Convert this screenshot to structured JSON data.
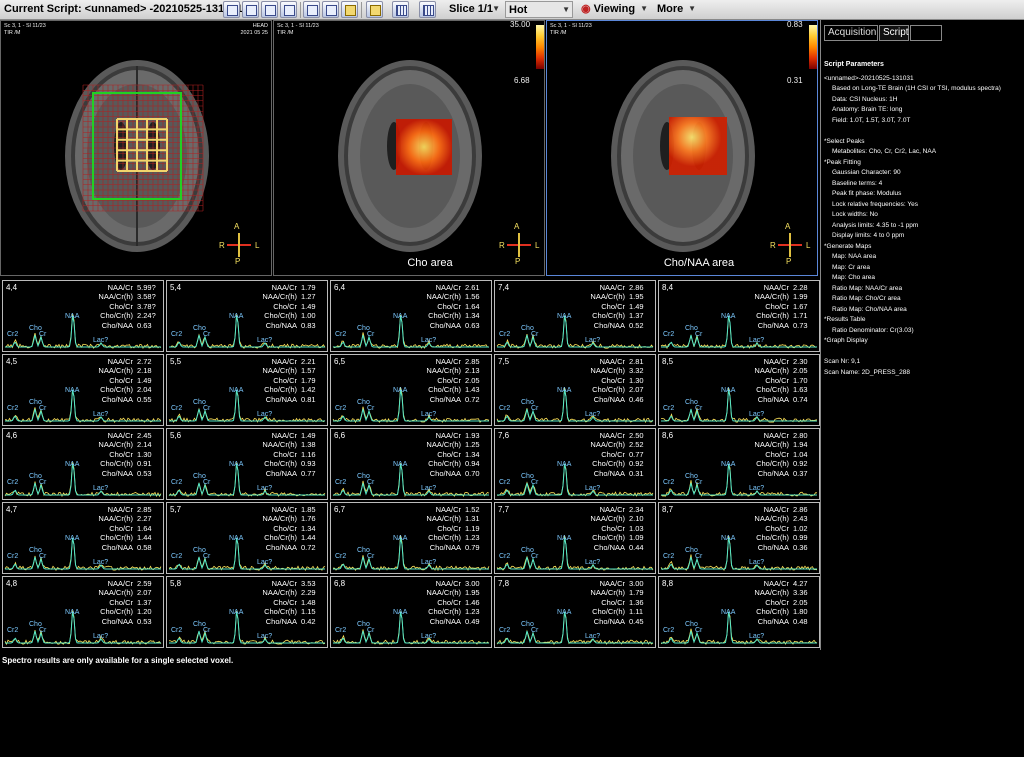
{
  "toolbar": {
    "current_script_label": "Current Script: <unnamed> -20210525-131031",
    "slice_label": "Slice 1/1",
    "lut_label": "Hot",
    "viewing_label": "Viewing",
    "more_label": "More"
  },
  "viewports": [
    {
      "info_tl": "Sc 3, 1 - Sl 11/23",
      "info_tl2": "TIR  /M",
      "info_tr": "HEAD",
      "info_tr2": "2021 05 25",
      "colorbar": null,
      "area_label": ""
    },
    {
      "info_tl": "Sc 3, 1 - Sl 11/23",
      "info_tl2": "TIR  /M",
      "info_tr": "",
      "info_tr2": "2021 05 25",
      "colorbar": {
        "max": "35.00",
        "min": "6.68"
      },
      "area_label": "Cho area"
    },
    {
      "info_tl": "Sc 3, 1 - Sl 11/23",
      "info_tl2": "TIR  /M",
      "info_tr": "",
      "info_tr2": "2021 05 25",
      "colorbar": {
        "max": "0.83",
        "min": "0.31"
      },
      "area_label": "Cho/NAA area"
    }
  ],
  "orientation": {
    "anterior": "A",
    "posterior": "P",
    "right": "R",
    "left": "L"
  },
  "peak_labels": {
    "cr2": "Cr2",
    "cho": "Cho",
    "cr": "Cr",
    "naa": "NAA",
    "lac": "Lac?"
  },
  "spectra": [
    {
      "coord": "4,4",
      "ratios": [
        [
          "NAA/Cr",
          "5.99?"
        ],
        [
          "NAA/Cr(h)",
          "3.58?"
        ],
        [
          "Cho/Cr",
          "3.78?"
        ],
        [
          "Cho/Cr(h)",
          "2.24?"
        ],
        [
          "Cho/NAA",
          "0.63"
        ]
      ]
    },
    {
      "coord": "5,4",
      "ratios": [
        [
          "NAA/Cr",
          "1.79"
        ],
        [
          "NAA/Cr(h)",
          "1.27"
        ],
        [
          "Cho/Cr",
          "1.49"
        ],
        [
          "Cho/Cr(h)",
          "1.00"
        ],
        [
          "Cho/NAA",
          "0.83"
        ]
      ]
    },
    {
      "coord": "6,4",
      "ratios": [
        [
          "NAA/Cr",
          "2.61"
        ],
        [
          "NAA/Cr(h)",
          "1.56"
        ],
        [
          "Cho/Cr",
          "1.64"
        ],
        [
          "Cho/Cr(h)",
          "1.34"
        ],
        [
          "Cho/NAA",
          "0.63"
        ]
      ]
    },
    {
      "coord": "7,4",
      "ratios": [
        [
          "NAA/Cr",
          "2.86"
        ],
        [
          "NAA/Cr(h)",
          "1.95"
        ],
        [
          "Cho/Cr",
          "1.49"
        ],
        [
          "Cho/Cr(h)",
          "1.37"
        ],
        [
          "Cho/NAA",
          "0.52"
        ]
      ]
    },
    {
      "coord": "8,4",
      "ratios": [
        [
          "NAA/Cr",
          "2.28"
        ],
        [
          "NAA/Cr(h)",
          "1.99"
        ],
        [
          "Cho/Cr",
          "1.67"
        ],
        [
          "Cho/Cr(h)",
          "1.71"
        ],
        [
          "Cho/NAA",
          "0.73"
        ]
      ]
    },
    {
      "coord": "4,5",
      "ratios": [
        [
          "NAA/Cr",
          "2.72"
        ],
        [
          "NAA/Cr(h)",
          "2.18"
        ],
        [
          "Cho/Cr",
          "1.49"
        ],
        [
          "Cho/Cr(h)",
          "2.04"
        ],
        [
          "Cho/NAA",
          "0.55"
        ]
      ]
    },
    {
      "coord": "5,5",
      "ratios": [
        [
          "NAA/Cr",
          "2.21"
        ],
        [
          "NAA/Cr(h)",
          "1.57"
        ],
        [
          "Cho/Cr",
          "1.79"
        ],
        [
          "Cho/Cr(h)",
          "1.42"
        ],
        [
          "Cho/NAA",
          "0.81"
        ]
      ]
    },
    {
      "coord": "6,5",
      "ratios": [
        [
          "NAA/Cr",
          "2.85"
        ],
        [
          "NAA/Cr(h)",
          "2.13"
        ],
        [
          "Cho/Cr",
          "2.05"
        ],
        [
          "Cho/Cr(h)",
          "1.43"
        ],
        [
          "Cho/NAA",
          "0.72"
        ]
      ]
    },
    {
      "coord": "7,5",
      "ratios": [
        [
          "NAA/Cr",
          "2.81"
        ],
        [
          "NAA/Cr(h)",
          "3.32"
        ],
        [
          "Cho/Cr",
          "1.30"
        ],
        [
          "Cho/Cr(h)",
          "2.07"
        ],
        [
          "Cho/NAA",
          "0.46"
        ]
      ]
    },
    {
      "coord": "8,5",
      "ratios": [
        [
          "NAA/Cr",
          "2.30"
        ],
        [
          "NAA/Cr(h)",
          "2.05"
        ],
        [
          "Cho/Cr",
          "1.70"
        ],
        [
          "Cho/Cr(h)",
          "1.63"
        ],
        [
          "Cho/NAA",
          "0.74"
        ]
      ]
    },
    {
      "coord": "4,6",
      "ratios": [
        [
          "NAA/Cr",
          "2.45"
        ],
        [
          "NAA/Cr(h)",
          "2.14"
        ],
        [
          "Cho/Cr",
          "1.30"
        ],
        [
          "Cho/Cr(h)",
          "0.91"
        ],
        [
          "Cho/NAA",
          "0.53"
        ]
      ]
    },
    {
      "coord": "5,6",
      "ratios": [
        [
          "NAA/Cr",
          "1.49"
        ],
        [
          "NAA/Cr(h)",
          "1.38"
        ],
        [
          "Cho/Cr",
          "1.16"
        ],
        [
          "Cho/Cr(h)",
          "0.93"
        ],
        [
          "Cho/NAA",
          "0.77"
        ]
      ]
    },
    {
      "coord": "6,6",
      "ratios": [
        [
          "NAA/Cr",
          "1.93"
        ],
        [
          "NAA/Cr(h)",
          "1.25"
        ],
        [
          "Cho/Cr",
          "1.34"
        ],
        [
          "Cho/Cr(h)",
          "0.94"
        ],
        [
          "Cho/NAA",
          "0.70"
        ]
      ]
    },
    {
      "coord": "7,6",
      "ratios": [
        [
          "NAA/Cr",
          "2.50"
        ],
        [
          "NAA/Cr(h)",
          "2.52"
        ],
        [
          "Cho/Cr",
          "0.77"
        ],
        [
          "Cho/Cr(h)",
          "0.92"
        ],
        [
          "Cho/NAA",
          "0.31"
        ]
      ]
    },
    {
      "coord": "8,6",
      "ratios": [
        [
          "NAA/Cr",
          "2.80"
        ],
        [
          "NAA/Cr(h)",
          "1.94"
        ],
        [
          "Cho/Cr",
          "1.04"
        ],
        [
          "Cho/Cr(h)",
          "0.92"
        ],
        [
          "Cho/NAA",
          "0.37"
        ]
      ]
    },
    {
      "coord": "4,7",
      "ratios": [
        [
          "NAA/Cr",
          "2.85"
        ],
        [
          "NAA/Cr(h)",
          "2.27"
        ],
        [
          "Cho/Cr",
          "1.64"
        ],
        [
          "Cho/Cr(h)",
          "1.44"
        ],
        [
          "Cho/NAA",
          "0.58"
        ]
      ]
    },
    {
      "coord": "5,7",
      "ratios": [
        [
          "NAA/Cr",
          "1.85"
        ],
        [
          "NAA/Cr(h)",
          "1.76"
        ],
        [
          "Cho/Cr",
          "1.34"
        ],
        [
          "Cho/Cr(h)",
          "1.44"
        ],
        [
          "Cho/NAA",
          "0.72"
        ]
      ]
    },
    {
      "coord": "6,7",
      "ratios": [
        [
          "NAA/Cr",
          "1.52"
        ],
        [
          "NAA/Cr(h)",
          "1.31"
        ],
        [
          "Cho/Cr",
          "1.19"
        ],
        [
          "Cho/Cr(h)",
          "1.23"
        ],
        [
          "Cho/NAA",
          "0.79"
        ]
      ]
    },
    {
      "coord": "7,7",
      "ratios": [
        [
          "NAA/Cr",
          "2.34"
        ],
        [
          "NAA/Cr(h)",
          "2.10"
        ],
        [
          "Cho/Cr",
          "1.03"
        ],
        [
          "Cho/Cr(h)",
          "1.09"
        ],
        [
          "Cho/NAA",
          "0.44"
        ]
      ]
    },
    {
      "coord": "8,7",
      "ratios": [
        [
          "NAA/Cr",
          "2.86"
        ],
        [
          "NAA/Cr(h)",
          "2.43"
        ],
        [
          "Cho/Cr",
          "1.02"
        ],
        [
          "Cho/Cr(h)",
          "0.99"
        ],
        [
          "Cho/NAA",
          "0.36"
        ]
      ]
    },
    {
      "coord": "4,8",
      "ratios": [
        [
          "NAA/Cr",
          "2.59"
        ],
        [
          "NAA/Cr(h)",
          "2.07"
        ],
        [
          "Cho/Cr",
          "1.37"
        ],
        [
          "Cho/Cr(h)",
          "1.20"
        ],
        [
          "Cho/NAA",
          "0.53"
        ]
      ]
    },
    {
      "coord": "5,8",
      "ratios": [
        [
          "NAA/Cr",
          "3.53"
        ],
        [
          "NAA/Cr(h)",
          "2.29"
        ],
        [
          "Cho/Cr",
          "1.48"
        ],
        [
          "Cho/Cr(h)",
          "1.15"
        ],
        [
          "Cho/NAA",
          "0.42"
        ]
      ]
    },
    {
      "coord": "6,8",
      "ratios": [
        [
          "NAA/Cr",
          "3.00"
        ],
        [
          "NAA/Cr(h)",
          "1.95"
        ],
        [
          "Cho/Cr",
          "1.46"
        ],
        [
          "Cho/Cr(h)",
          "1.23"
        ],
        [
          "Cho/NAA",
          "0.49"
        ]
      ]
    },
    {
      "coord": "7,8",
      "ratios": [
        [
          "NAA/Cr",
          "3.00"
        ],
        [
          "NAA/Cr(h)",
          "1.79"
        ],
        [
          "Cho/Cr",
          "1.36"
        ],
        [
          "Cho/Cr(h)",
          "1.11"
        ],
        [
          "Cho/NAA",
          "0.45"
        ]
      ]
    },
    {
      "coord": "8,8",
      "ratios": [
        [
          "NAA/Cr",
          "4.27"
        ],
        [
          "NAA/Cr(h)",
          "3.36"
        ],
        [
          "Cho/Cr",
          "2.05"
        ],
        [
          "Cho/Cr(h)",
          "1.80"
        ],
        [
          "Cho/NAA",
          "0.48"
        ]
      ]
    }
  ],
  "status_text": "Spectro results are only available for a single selected voxel.",
  "panel": {
    "tabs": [
      "Acquisition",
      "Script",
      ""
    ],
    "active_tab": 1,
    "heading": "Script Parameters",
    "lines": [
      {
        "text": "<unnamed>-20210525-131031",
        "indent": 0
      },
      {
        "text": "Based on Long-TE Brain (1H CSI or TSI, modulus spectra)",
        "indent": 1
      },
      {
        "text": "Data: CSI   Nucleus: 1H",
        "indent": 1
      },
      {
        "text": "Anatomy: Brain   TE: long",
        "indent": 1
      },
      {
        "text": "Field: 1.0T, 1.5T, 3.0T, 7.0T",
        "indent": 1
      },
      {
        "text": "",
        "indent": 0
      },
      {
        "text": "*Select Peaks",
        "indent": 0
      },
      {
        "text": "Metabolites: Cho, Cr, Cr2, Lac, NAA",
        "indent": 1
      },
      {
        "text": "*Peak Fitting",
        "indent": 0
      },
      {
        "text": "Gaussian Character: 90",
        "indent": 1
      },
      {
        "text": "Baseline terms: 4",
        "indent": 1
      },
      {
        "text": "Peak fit phase: Modulus",
        "indent": 1
      },
      {
        "text": "Lock relative frequencies: Yes",
        "indent": 1
      },
      {
        "text": "Lock widths: No",
        "indent": 1
      },
      {
        "text": "Analysis limits: 4.35 to -1 ppm",
        "indent": 1
      },
      {
        "text": "Display limits: 4 to 0 ppm",
        "indent": 1
      },
      {
        "text": "*Generate Maps",
        "indent": 0
      },
      {
        "text": "Map: NAA area",
        "indent": 1
      },
      {
        "text": "Map: Cr area",
        "indent": 1
      },
      {
        "text": "Map: Cho area",
        "indent": 1
      },
      {
        "text": "Ratio Map: NAA/Cr area",
        "indent": 1
      },
      {
        "text": "Ratio Map: Cho/Cr area",
        "indent": 1
      },
      {
        "text": "Ratio Map: Cho/NAA area",
        "indent": 1
      },
      {
        "text": "*Results Table",
        "indent": 0
      },
      {
        "text": "Ratio Denominator: Cr(3.03)",
        "indent": 1
      },
      {
        "text": "*Graph Display",
        "indent": 0
      },
      {
        "text": "",
        "indent": 0
      },
      {
        "text": "Scan Nr: 9,1",
        "indent": 0
      },
      {
        "text": "Scan Name: 2D_PRESS_288",
        "indent": 0
      }
    ]
  },
  "colors": {
    "spectrum_line": "#ffe45a",
    "fit_line": "#52e6c8",
    "peak_label": "#7cc9ff",
    "grid_voi": "#22d022",
    "grid_voxel": "#f2d56a",
    "hot_map": "#ff5a1a"
  }
}
